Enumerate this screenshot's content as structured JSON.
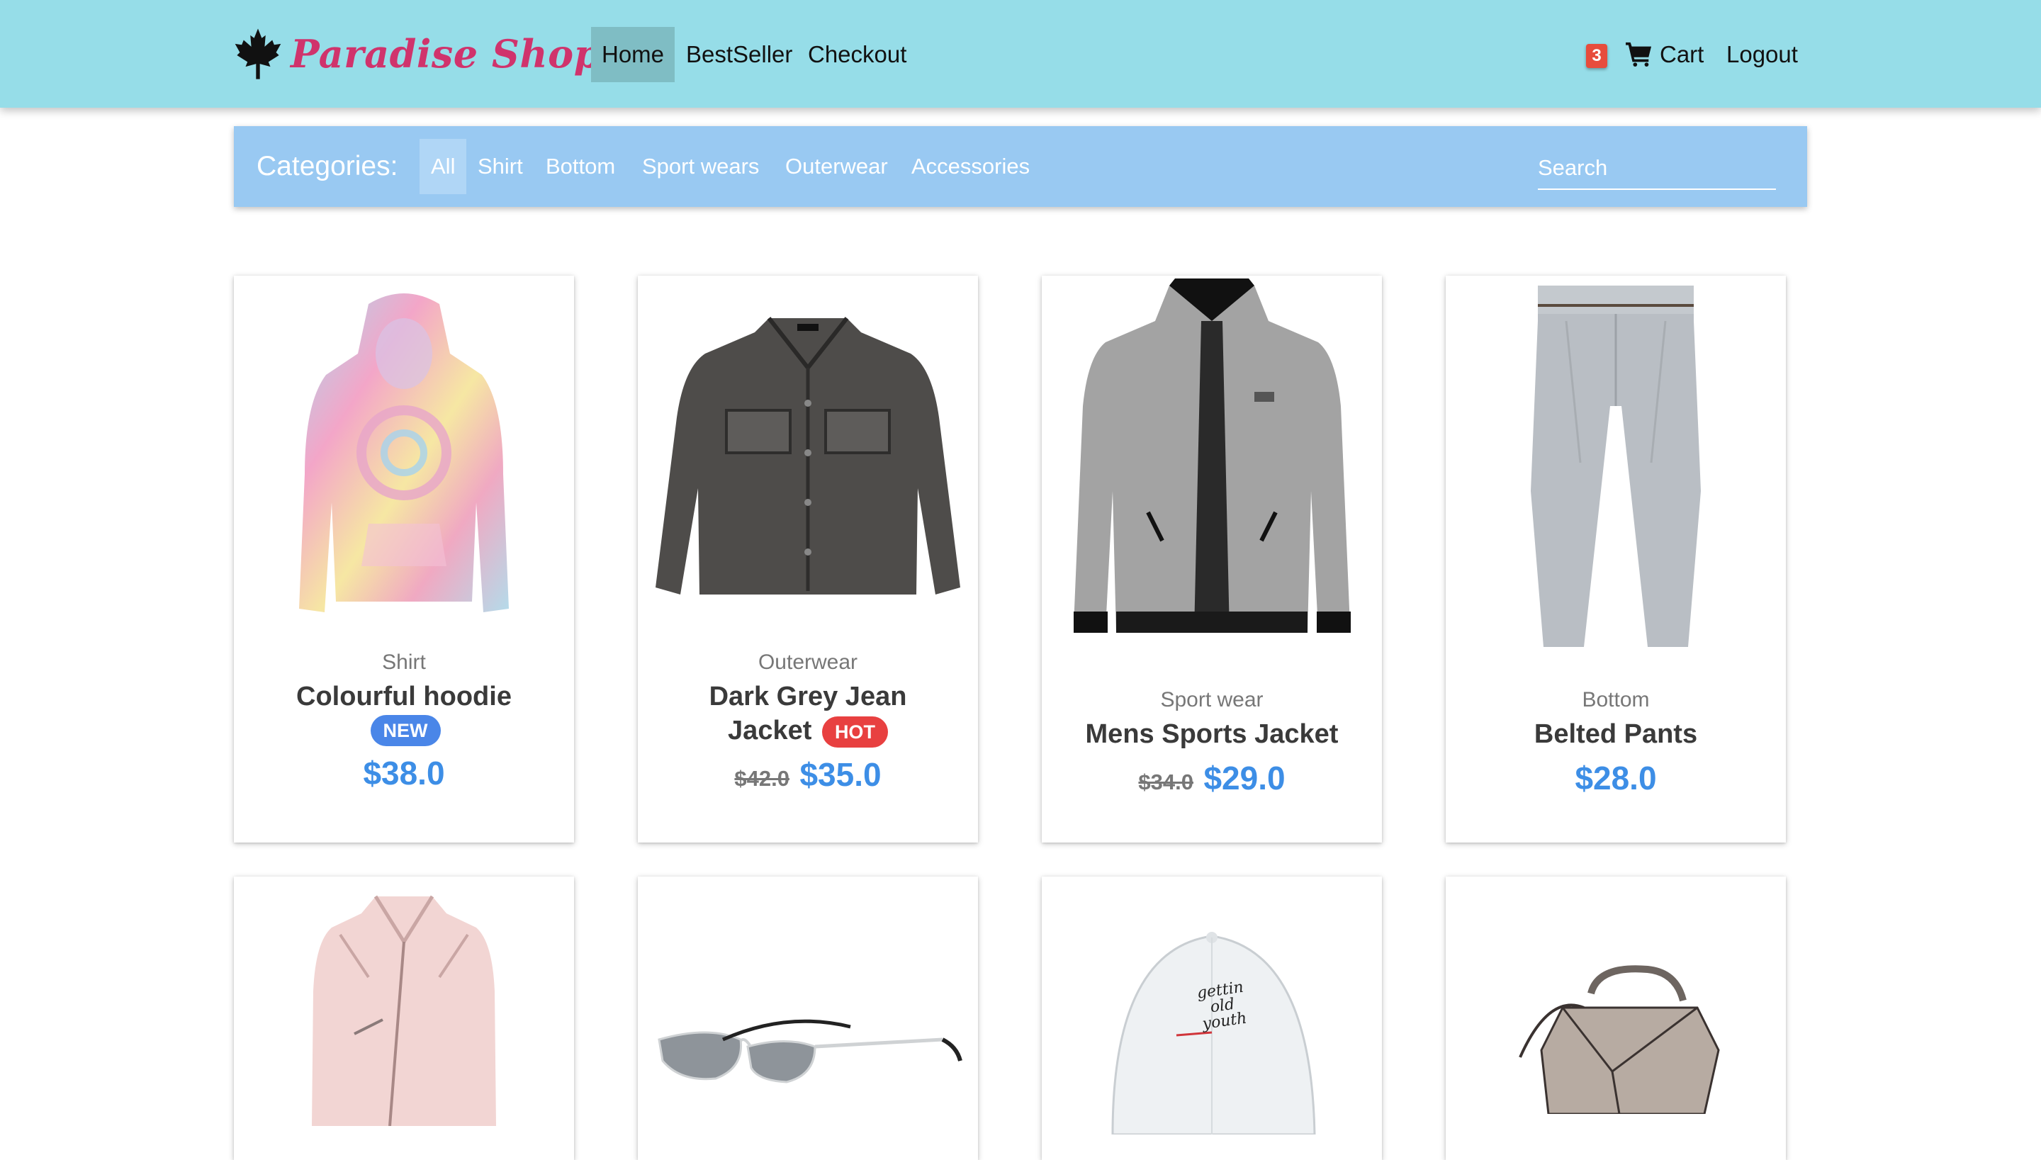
{
  "brand": {
    "name": "Paradise Shop",
    "logo_icon": "maple-leaf-icon"
  },
  "nav": {
    "links": [
      {
        "label": "Home",
        "active": true
      },
      {
        "label": "BestSeller"
      },
      {
        "label": "Checkout"
      }
    ],
    "cart_count": "3",
    "cart_label": "Cart",
    "logout_label": "Logout"
  },
  "categories": {
    "label": "Categories:",
    "items": [
      "All",
      "Shirt",
      "Bottom",
      "Sport wears",
      "Outerwear",
      "Accessories"
    ],
    "active": "All",
    "search_placeholder": "Search"
  },
  "products": [
    {
      "category": "Shirt",
      "title": "Colourful hoodie",
      "badge": "NEW",
      "old_price": "",
      "price": "$38.0",
      "image": "tie-dye-hoodie"
    },
    {
      "category": "Outerwear",
      "title_line1": "Dark Grey Jean",
      "title_line2": "Jacket",
      "badge": "HOT",
      "old_price": "$42.0",
      "price": "$35.0",
      "image": "denim-jacket"
    },
    {
      "category": "Sport wear",
      "title": "Mens Sports Jacket",
      "badge": "",
      "old_price": "$34.0",
      "price": "$29.0",
      "image": "sports-jacket"
    },
    {
      "category": "Bottom",
      "title": "Belted Pants",
      "badge": "",
      "old_price": "",
      "price": "$28.0",
      "image": "belted-pants"
    },
    {
      "image": "pink-leather-jacket"
    },
    {
      "image": "cat-eye-sunglasses"
    },
    {
      "image": "white-cap",
      "cap_text": [
        "gettin",
        "old",
        "youth"
      ]
    },
    {
      "image": "grey-handbag"
    }
  ],
  "colors": {
    "navbar_bg": "#96dde8",
    "brand": "#d0336c",
    "category_bar_bg": "#99c9f2",
    "price": "#3d8ee6",
    "badge_new": "#4a86e8",
    "badge_hot": "#e84040",
    "cart_badge": "#e74c3c"
  }
}
